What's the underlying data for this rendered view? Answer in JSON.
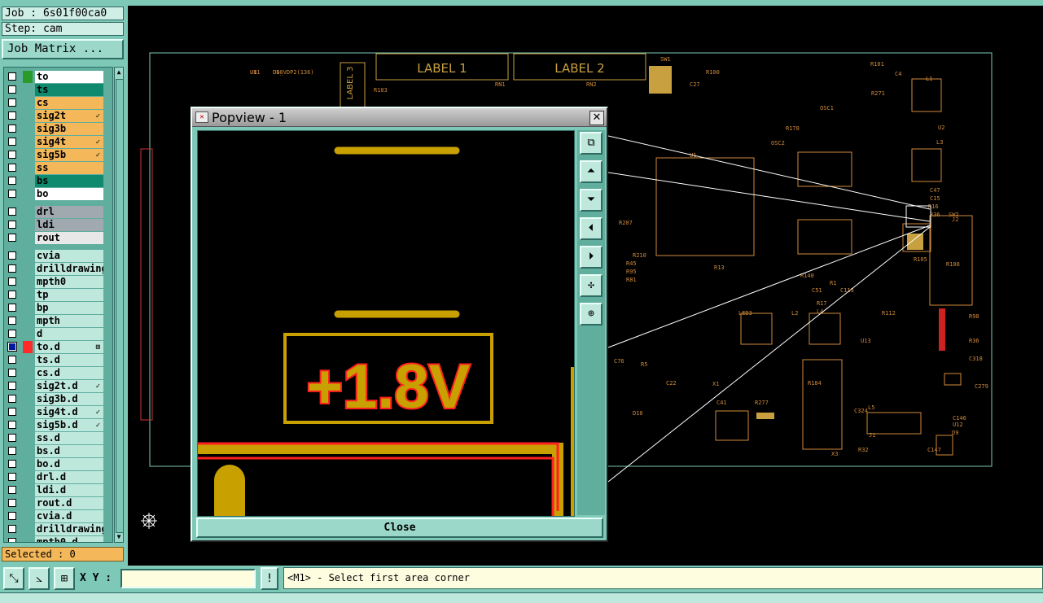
{
  "job_label": "Job : 6s01f00ca0",
  "step_label": "Step: cam",
  "job_matrix_button": "Job Matrix ...",
  "layers": [
    {
      "name": "to",
      "color": "#2a9a2a",
      "bg": "#ffffff"
    },
    {
      "name": "ts",
      "color": "",
      "bg": "#0f8a6e"
    },
    {
      "name": "cs",
      "color": "",
      "bg": "#f4b85a"
    },
    {
      "name": "sig2t",
      "color": "",
      "bg": "#f4b85a",
      "mark": "✓"
    },
    {
      "name": "sig3b",
      "color": "",
      "bg": "#f4b85a"
    },
    {
      "name": "sig4t",
      "color": "",
      "bg": "#f4b85a",
      "mark": "✓"
    },
    {
      "name": "sig5b",
      "color": "",
      "bg": "#f4b85a",
      "mark": "✓"
    },
    {
      "name": "ss",
      "color": "",
      "bg": "#f4b85a"
    },
    {
      "name": "bs",
      "color": "",
      "bg": "#0f8a6e"
    },
    {
      "name": "bo",
      "color": "",
      "bg": "#ffffff"
    },
    {
      "name": "drl",
      "color": "",
      "bg": "#a0a8b0"
    },
    {
      "name": "ldi",
      "color": "",
      "bg": "#a0a8b0"
    },
    {
      "name": "rout",
      "color": "",
      "bg": "#e8e8e8"
    },
    {
      "name": "cvia",
      "color": "",
      "bg": "#bfe8dd"
    },
    {
      "name": "drilldrawing",
      "color": "",
      "bg": "#bfe8dd"
    },
    {
      "name": "mpth0",
      "color": "",
      "bg": "#bfe8dd"
    },
    {
      "name": "tp",
      "color": "",
      "bg": "#bfe8dd"
    },
    {
      "name": "bp",
      "color": "",
      "bg": "#bfe8dd"
    },
    {
      "name": "mpth",
      "color": "",
      "bg": "#bfe8dd"
    },
    {
      "name": "d",
      "color": "",
      "bg": "#bfe8dd"
    },
    {
      "name": "to.d",
      "color": "#ff2a2a",
      "bg": "#bfe8dd",
      "checked": true,
      "mark": "⊞"
    },
    {
      "name": "ts.d",
      "color": "",
      "bg": "#bfe8dd"
    },
    {
      "name": "cs.d",
      "color": "",
      "bg": "#bfe8dd"
    },
    {
      "name": "sig2t.d",
      "color": "",
      "bg": "#bfe8dd",
      "mark": "✓"
    },
    {
      "name": "sig3b.d",
      "color": "",
      "bg": "#bfe8dd"
    },
    {
      "name": "sig4t.d",
      "color": "",
      "bg": "#bfe8dd",
      "mark": "✓"
    },
    {
      "name": "sig5b.d",
      "color": "",
      "bg": "#bfe8dd",
      "mark": "✓"
    },
    {
      "name": "ss.d",
      "color": "",
      "bg": "#bfe8dd"
    },
    {
      "name": "bs.d",
      "color": "",
      "bg": "#bfe8dd"
    },
    {
      "name": "bo.d",
      "color": "",
      "bg": "#bfe8dd"
    },
    {
      "name": "drl.d",
      "color": "",
      "bg": "#bfe8dd"
    },
    {
      "name": "ldi.d",
      "color": "",
      "bg": "#bfe8dd"
    },
    {
      "name": "rout.d",
      "color": "",
      "bg": "#bfe8dd"
    },
    {
      "name": "cvia.d",
      "color": "",
      "bg": "#bfe8dd"
    },
    {
      "name": "drilldrawing",
      "color": "",
      "bg": "#bfe8dd"
    },
    {
      "name": "mpth0.d",
      "color": "",
      "bg": "#bfe8dd"
    }
  ],
  "selected_label": "Selected : 0",
  "popup": {
    "title": "Popview - 1",
    "close_x": "✕",
    "close_button": "Close",
    "label_text": "+1.8V",
    "tool_icons": [
      "zoom-fit-icon",
      "pan-up-icon",
      "pan-down-icon",
      "pan-left-icon",
      "pan-right-icon",
      "zoom-in-icon",
      "zoom-out-icon"
    ]
  },
  "board": {
    "label1": "LABEL 1",
    "label2": "LABEL 2",
    "label3": "LABEL 3",
    "refs": [
      "U11",
      "U10",
      "R103",
      "RN1",
      "RN2",
      "SW1",
      "R100",
      "C27",
      "R101",
      "R271",
      "C4",
      "L1",
      "OSC1",
      "OSC2",
      "R178",
      "U2",
      "L3",
      "C47",
      "C15",
      "R16",
      "R36",
      "SW2",
      "J2",
      "U1",
      "R207",
      "R210",
      "R45",
      "R95",
      "R81",
      "R13",
      "R140",
      "R1",
      "C51",
      "C113",
      "R17",
      "R105",
      "R108",
      "LED3",
      "L2",
      "L4",
      "U13",
      "R112",
      "R98",
      "R36",
      "C318",
      "C279",
      "X1",
      "C41",
      "R277",
      "R184",
      "C324",
      "L5",
      "J1",
      "X3",
      "R32",
      "C147",
      "C146",
      "U12",
      "D9",
      "D10",
      "R5",
      "C22",
      "C76",
      "U8",
      "C6_VDP2(136)"
    ]
  },
  "toolbar": {
    "xy_label": "X Y :",
    "xy_value": "",
    "alert_icon": "!",
    "prompt_text": "<M1> - Select first area corner"
  }
}
